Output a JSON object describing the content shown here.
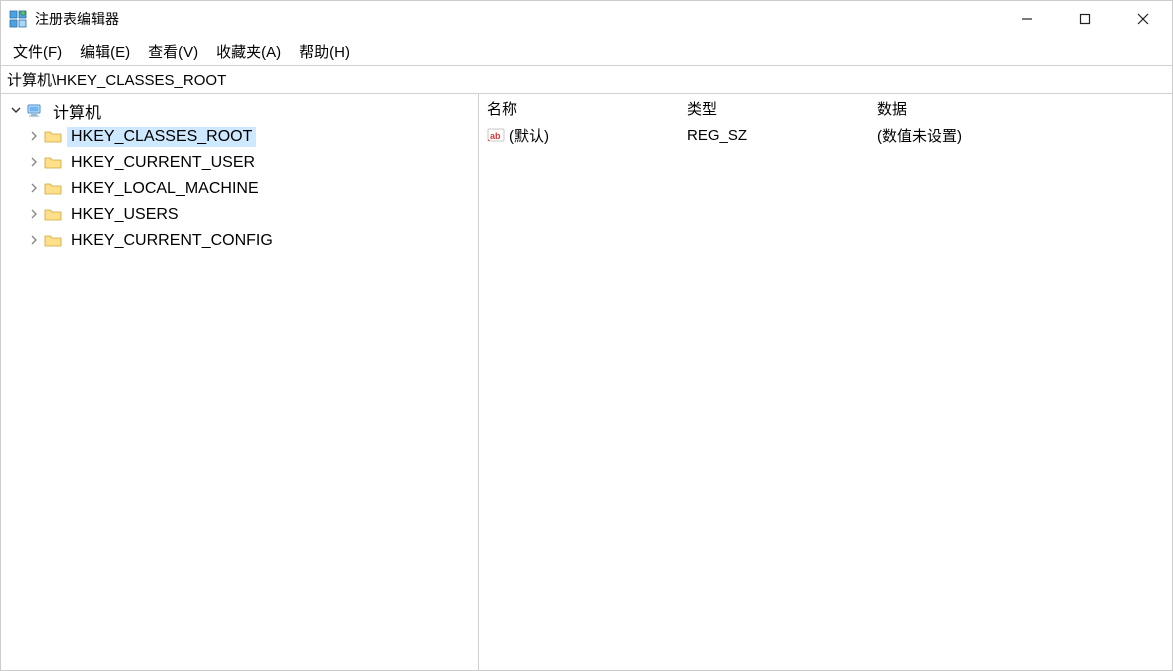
{
  "window": {
    "title": "注册表编辑器"
  },
  "menubar": {
    "items": [
      "文件(F)",
      "编辑(E)",
      "查看(V)",
      "收藏夹(A)",
      "帮助(H)"
    ]
  },
  "addressbar": {
    "path": "计算机\\HKEY_CLASSES_ROOT"
  },
  "tree": {
    "root": {
      "label": "计算机",
      "expanded": true
    },
    "children": [
      {
        "label": "HKEY_CLASSES_ROOT",
        "selected": true
      },
      {
        "label": "HKEY_CURRENT_USER"
      },
      {
        "label": "HKEY_LOCAL_MACHINE"
      },
      {
        "label": "HKEY_USERS"
      },
      {
        "label": "HKEY_CURRENT_CONFIG"
      }
    ]
  },
  "list": {
    "headers": {
      "name": "名称",
      "type": "类型",
      "data": "数据"
    },
    "rows": [
      {
        "name": "(默认)",
        "type": "REG_SZ",
        "data": "(数值未设置)"
      }
    ]
  }
}
